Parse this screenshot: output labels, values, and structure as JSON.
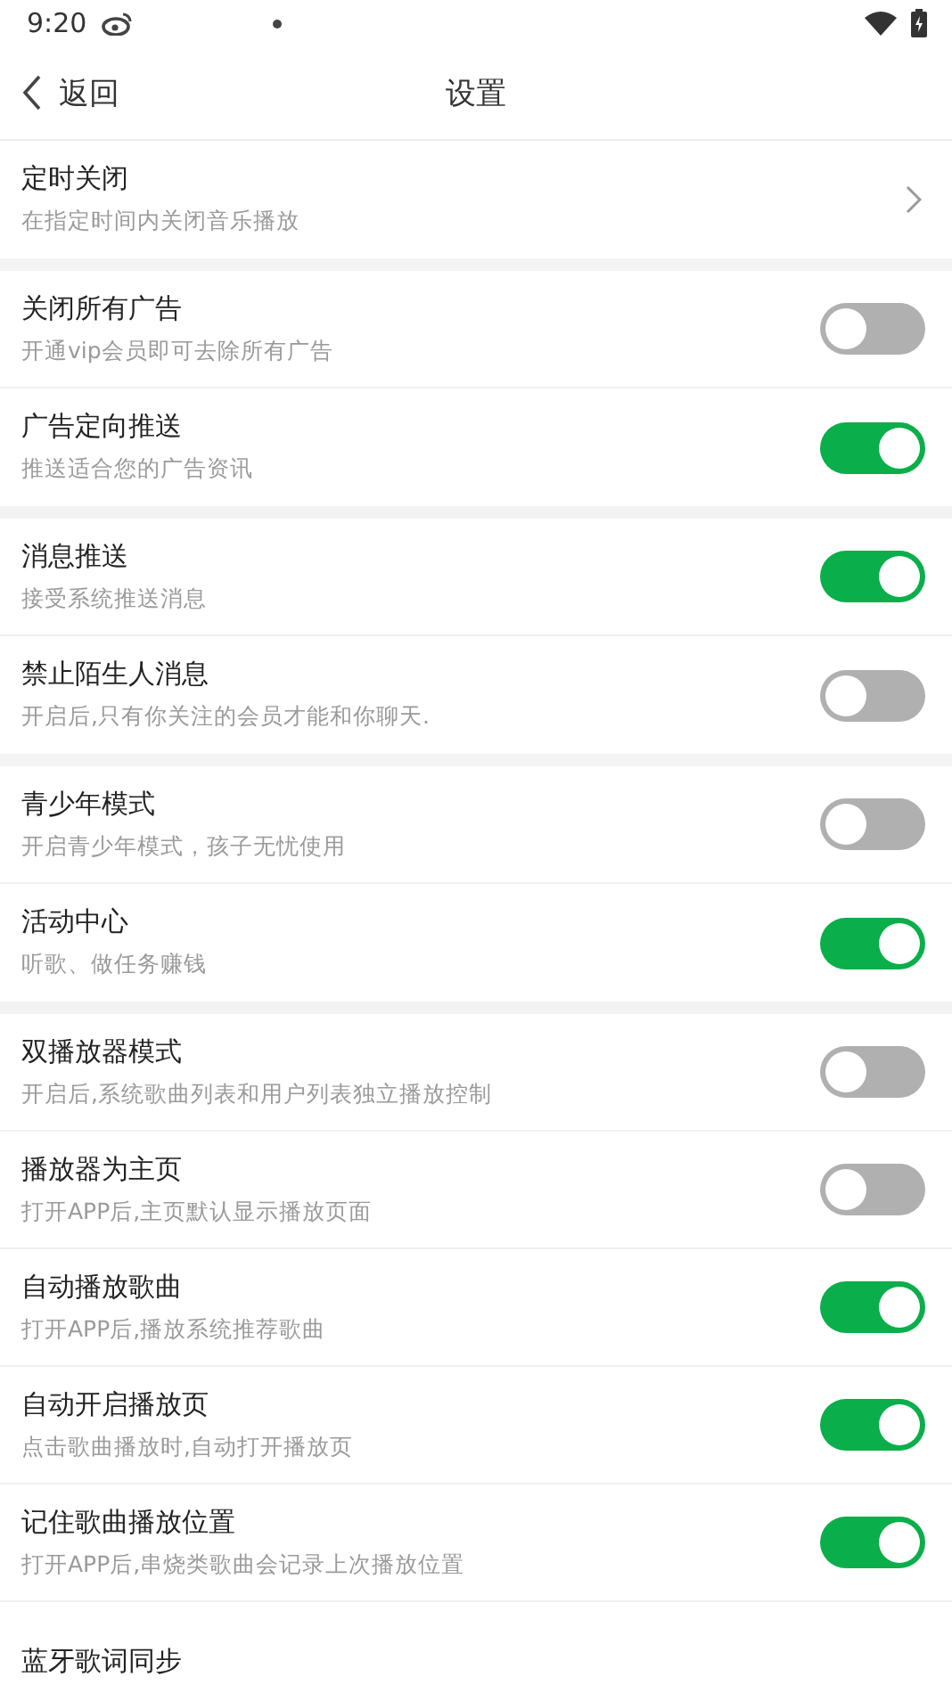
{
  "status_bar": {
    "time": "9:20"
  },
  "header": {
    "back_label": "返回",
    "title": "设置"
  },
  "groups": [
    {
      "items": [
        {
          "kind": "link",
          "title": "定时关闭",
          "subtitle": "在指定时间内关闭音乐播放"
        }
      ]
    },
    {
      "items": [
        {
          "kind": "toggle",
          "title": "关闭所有广告",
          "subtitle": "开通vip会员即可去除所有广告",
          "on": false
        },
        {
          "kind": "toggle",
          "title": "广告定向推送",
          "subtitle": "推送适合您的广告资讯",
          "on": true
        }
      ]
    },
    {
      "items": [
        {
          "kind": "toggle",
          "title": "消息推送",
          "subtitle": "接受系统推送消息",
          "on": true
        },
        {
          "kind": "toggle",
          "title": "禁止陌生人消息",
          "subtitle": "开启后,只有你关注的会员才能和你聊天.",
          "on": false
        }
      ]
    },
    {
      "items": [
        {
          "kind": "toggle",
          "title": "青少年模式",
          "subtitle": "开启青少年模式，孩子无忧使用",
          "on": false
        },
        {
          "kind": "toggle",
          "title": "活动中心",
          "subtitle": "听歌、做任务赚钱",
          "on": true
        }
      ]
    },
    {
      "items": [
        {
          "kind": "toggle",
          "title": "双播放器模式",
          "subtitle": "开启后,系统歌曲列表和用户列表独立播放控制",
          "on": false
        },
        {
          "kind": "toggle",
          "title": "播放器为主页",
          "subtitle": "打开APP后,主页默认显示播放页面",
          "on": false
        },
        {
          "kind": "toggle",
          "title": "自动播放歌曲",
          "subtitle": "打开APP后,播放系统推荐歌曲",
          "on": true
        },
        {
          "kind": "toggle",
          "title": "自动开启播放页",
          "subtitle": "点击歌曲播放时,自动打开播放页",
          "on": true
        },
        {
          "kind": "toggle",
          "title": "记住歌曲播放位置",
          "subtitle": "打开APP后,串烧类歌曲会记录上次播放位置",
          "on": true
        },
        {
          "kind": "text",
          "title": "蓝牙歌词同步"
        }
      ]
    }
  ]
}
